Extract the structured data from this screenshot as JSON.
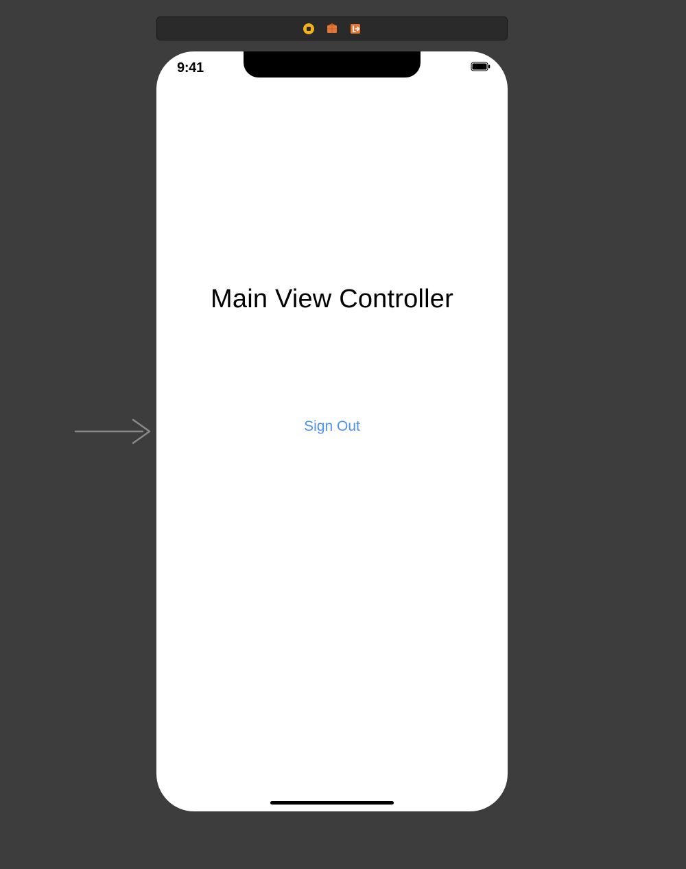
{
  "status_bar": {
    "time": "9:41"
  },
  "screen": {
    "title": "Main View Controller",
    "sign_out_label": "Sign Out"
  },
  "colors": {
    "background_canvas": "#3d3d3d",
    "device_screen": "#ffffff",
    "button_tint": "#4f91f2",
    "scene_dock_bg": "#2a2a2a",
    "dock_icon_yellow": "#f2b21a",
    "dock_icon_orange": "#e57836"
  },
  "dock_icons": {
    "first": "view-controller-icon",
    "second": "first-responder-icon",
    "third": "exit-icon"
  }
}
